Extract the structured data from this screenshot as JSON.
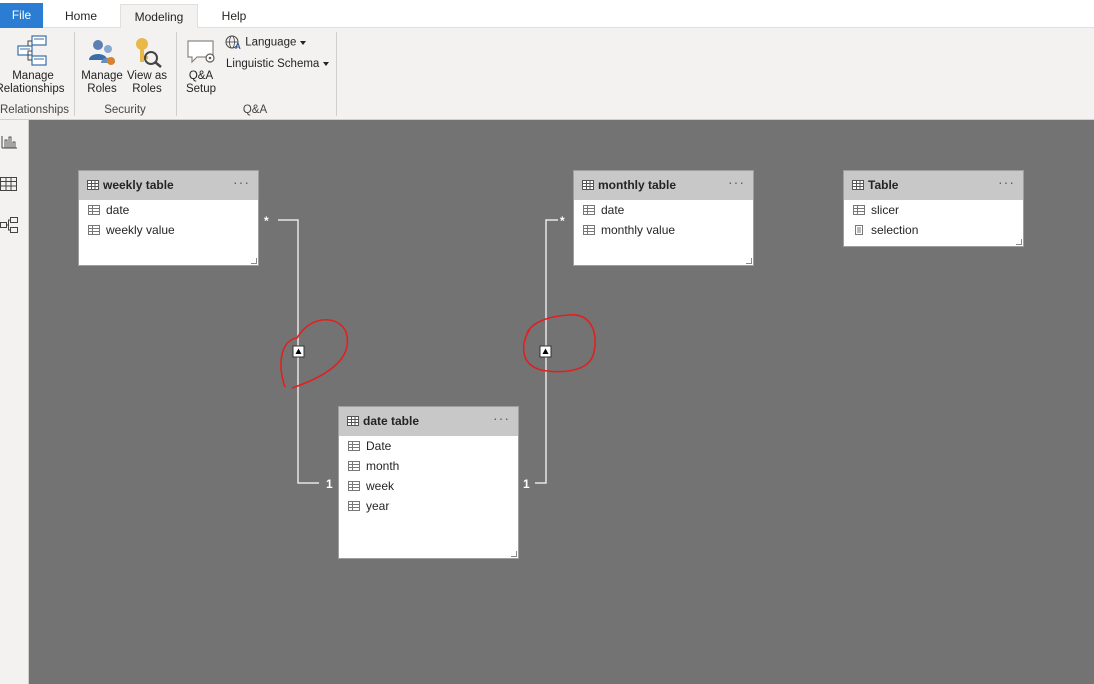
{
  "tabs": {
    "file": "File",
    "home": "Home",
    "modeling": "Modeling",
    "help": "Help"
  },
  "ribbon": {
    "manage_relationships": {
      "line1": "Manage",
      "line2": "Relationships"
    },
    "relationships_group": "Relationships",
    "manage_roles": {
      "line1": "Manage",
      "line2": "Roles"
    },
    "view_as_roles": {
      "line1": "View as",
      "line2": "Roles"
    },
    "security_group": "Security",
    "qa_setup": {
      "line1": "Q&A",
      "line2": "Setup"
    },
    "language": "Language",
    "linguistic_schema": "Linguistic Schema",
    "qa_group": "Q&A"
  },
  "tables": {
    "weekly": {
      "title": "weekly table",
      "fields": [
        "date",
        "weekly value"
      ]
    },
    "monthly": {
      "title": "monthly table",
      "fields": [
        "date",
        "monthly value"
      ]
    },
    "table": {
      "title": "Table",
      "fields": [
        "slicer",
        "selection"
      ]
    },
    "date": {
      "title": "date table",
      "fields": [
        "Date",
        "month",
        "week",
        "year"
      ]
    }
  },
  "relationships": {
    "weekly_many": "*",
    "weekly_one": "1",
    "monthly_many": "*",
    "monthly_one": "1"
  },
  "more_label": "···",
  "colors": {
    "file_tab": "#2b7cd3",
    "canvas": "#737373",
    "card_header": "#c8c8c8",
    "annotation": "#e02020"
  }
}
